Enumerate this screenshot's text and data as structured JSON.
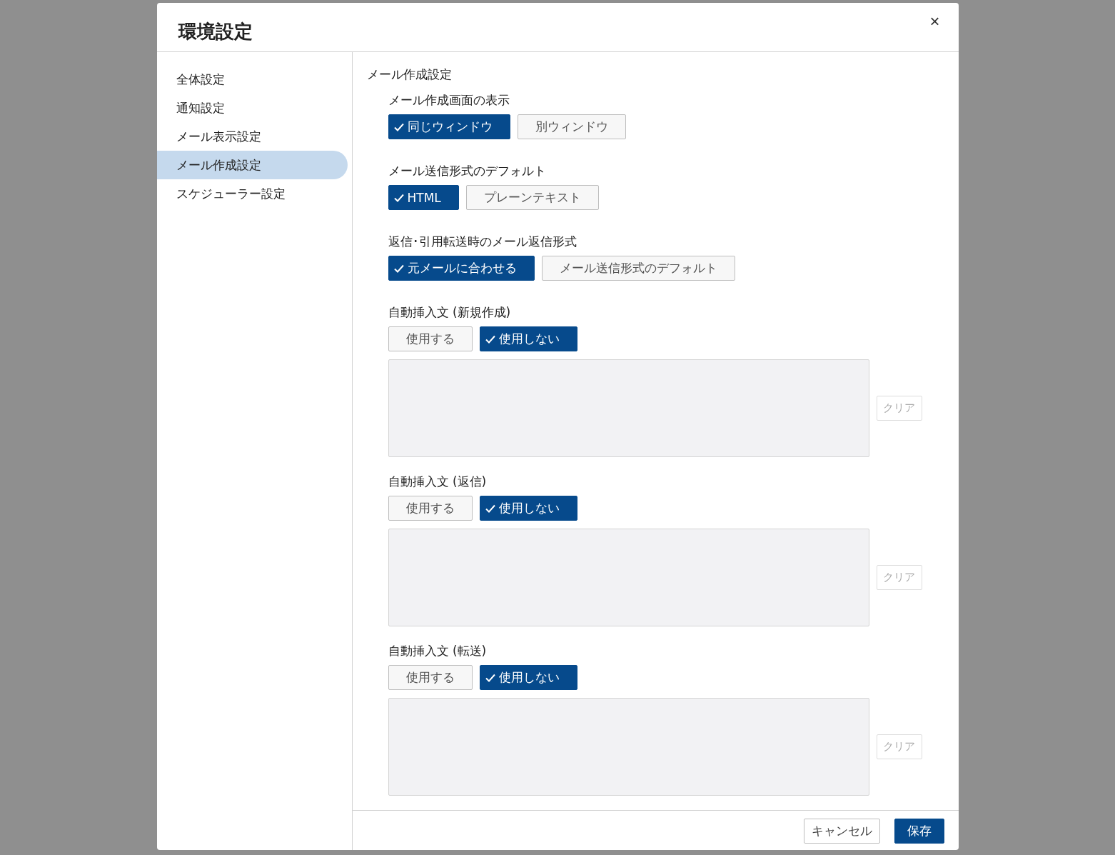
{
  "dialog": {
    "title": "環境設定",
    "close": "×"
  },
  "sidebar": {
    "items": [
      {
        "label": "全体設定",
        "selected": false
      },
      {
        "label": "通知設定",
        "selected": false
      },
      {
        "label": "メール表示設定",
        "selected": false
      },
      {
        "label": "メール作成設定",
        "selected": true
      },
      {
        "label": "スケジューラー設定",
        "selected": false
      }
    ]
  },
  "content": {
    "heading": "メール作成設定",
    "settings": [
      {
        "kind": "choice",
        "label": "メール作成画面の表示",
        "options": [
          {
            "label": "同じウィンドウ",
            "selected": true
          },
          {
            "label": "別ウィンドウ",
            "selected": false
          }
        ]
      },
      {
        "kind": "choice",
        "label": "メール送信形式のデフォルト",
        "options": [
          {
            "label": "HTML",
            "selected": true
          },
          {
            "label": "プレーンテキスト",
            "selected": false
          }
        ]
      },
      {
        "kind": "choice",
        "label": "返信･引用転送時のメール返信形式",
        "options": [
          {
            "label": "元メールに合わせる",
            "selected": true
          },
          {
            "label": "メール送信形式のデフォルト",
            "selected": false
          }
        ]
      },
      {
        "kind": "text",
        "label": "自動挿入文 (新規作成)",
        "options": [
          {
            "label": "使用する",
            "selected": false
          },
          {
            "label": "使用しない",
            "selected": true
          }
        ],
        "textarea": {
          "disabled": true
        },
        "clear": {
          "label": "クリア",
          "disabled": true
        }
      },
      {
        "kind": "text",
        "label": "自動挿入文 (返信)",
        "options": [
          {
            "label": "使用する",
            "selected": false
          },
          {
            "label": "使用しない",
            "selected": true
          }
        ],
        "textarea": {
          "disabled": true
        },
        "clear": {
          "label": "クリア",
          "disabled": true
        }
      },
      {
        "kind": "text",
        "label": "自動挿入文 (転送)",
        "options": [
          {
            "label": "使用する",
            "selected": false
          },
          {
            "label": "使用しない",
            "selected": true
          }
        ],
        "textarea": {
          "disabled": true
        },
        "clear": {
          "label": "クリア",
          "disabled": true
        }
      }
    ]
  },
  "footer": {
    "buttons": [
      {
        "label": "キャンセル",
        "kind": "secondary"
      },
      {
        "label": "保存",
        "kind": "primary"
      }
    ]
  }
}
